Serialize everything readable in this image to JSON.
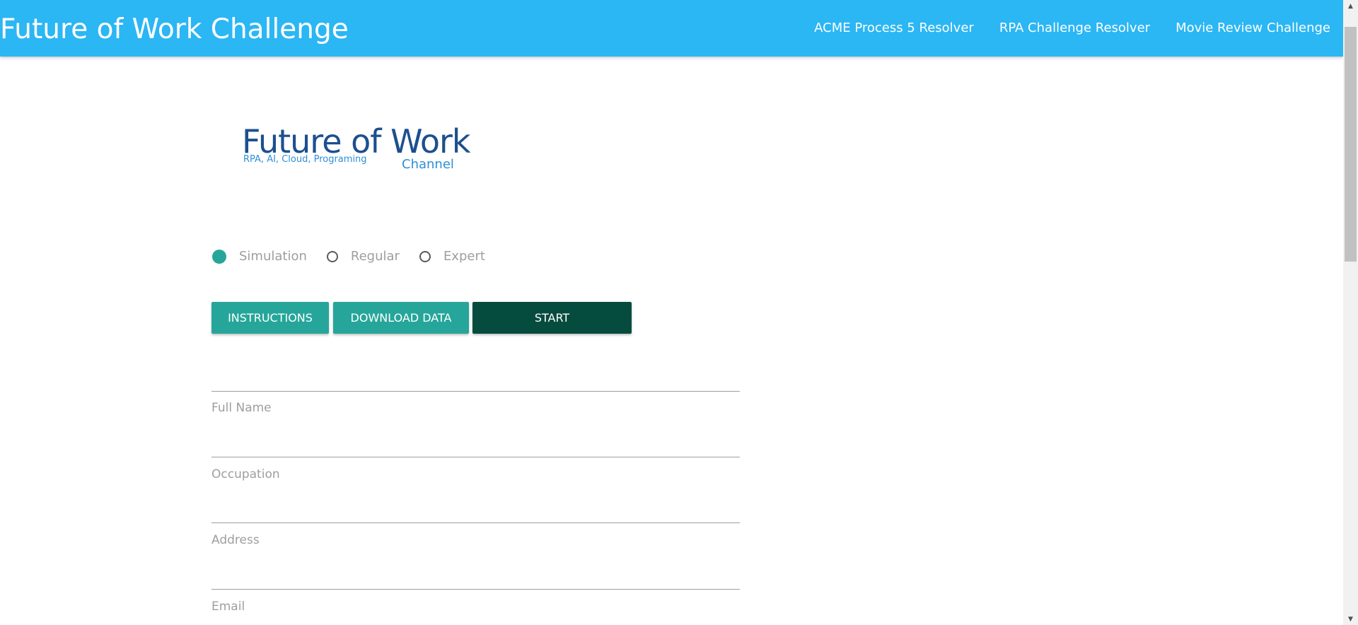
{
  "header": {
    "title": "Future of Work Challenge",
    "nav_links": [
      "ACME Process 5 Resolver",
      "RPA Challenge Resolver",
      "Movie Review Challenge"
    ],
    "background_color": "#2bb6f4"
  },
  "logo": {
    "title": "Future of Work",
    "tagline": "RPA, AI, Cloud, Programing",
    "channel": "Channel"
  },
  "modes": {
    "options": [
      "Simulation",
      "Regular",
      "Expert"
    ],
    "selected": "Simulation"
  },
  "buttons": {
    "instructions": "INSTRUCTIONS",
    "download": "DOWNLOAD DATA",
    "start": "START",
    "primary_color": "#26a69a",
    "start_color": "#064c3e"
  },
  "form": {
    "fields": [
      "Full Name",
      "Occupation",
      "Address",
      "Email"
    ]
  }
}
